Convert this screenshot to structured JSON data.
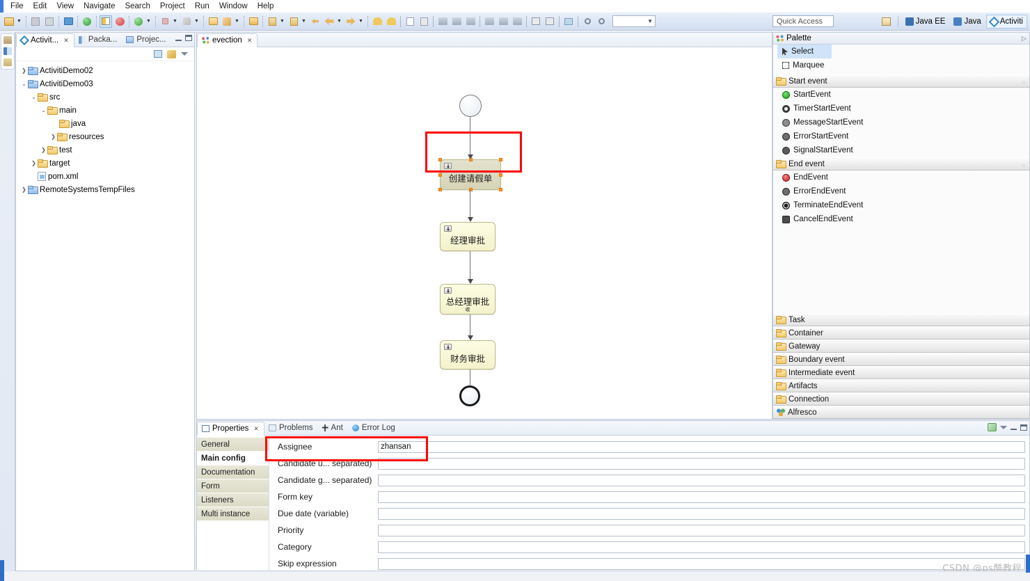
{
  "menubar": {
    "items": [
      "File",
      "Edit",
      "View",
      "Navigate",
      "Search",
      "Project",
      "Run",
      "Window",
      "Help"
    ]
  },
  "toolbar": {
    "quick_access_placeholder": "Quick Access",
    "zoom_combo_value": "",
    "perspectives": [
      {
        "label": "Java EE",
        "icon": "javaee-perspective-icon",
        "active": false
      },
      {
        "label": "Java",
        "icon": "java-perspective-icon",
        "active": false
      },
      {
        "label": "Activiti",
        "icon": "activiti-perspective-icon",
        "active": true
      }
    ],
    "open_perspective_icon": "open-perspective-icon"
  },
  "explorer": {
    "tabs": [
      {
        "label": "Activit...",
        "icon": "activiti-icon",
        "active": true,
        "closable": true
      },
      {
        "label": "Packa...",
        "icon": "package-explorer-icon",
        "active": false,
        "closable": false
      },
      {
        "label": "Projec...",
        "icon": "project-explorer-icon",
        "active": false,
        "closable": false
      }
    ],
    "view_actions": [
      "collapse-all-icon",
      "link-editor-icon",
      "view-menu-icon"
    ],
    "tree": [
      {
        "label": "ActivitiDemo02",
        "depth": 0,
        "twist": "collapsed",
        "icon": "project-folder"
      },
      {
        "label": "ActivitiDemo03",
        "depth": 0,
        "twist": "expanded",
        "icon": "project-folder"
      },
      {
        "label": "src",
        "depth": 1,
        "twist": "expanded",
        "icon": "folder"
      },
      {
        "label": "main",
        "depth": 2,
        "twist": "expanded",
        "icon": "folder"
      },
      {
        "label": "java",
        "depth": 3,
        "twist": "none",
        "icon": "folder"
      },
      {
        "label": "resources",
        "depth": 3,
        "twist": "collapsed",
        "icon": "folder"
      },
      {
        "label": "test",
        "depth": 2,
        "twist": "collapsed",
        "icon": "folder"
      },
      {
        "label": "target",
        "depth": 1,
        "twist": "collapsed",
        "icon": "folder"
      },
      {
        "label": "pom.xml",
        "depth": 1,
        "twist": "none",
        "icon": "file"
      },
      {
        "label": "RemoteSystemsTempFiles",
        "depth": 0,
        "twist": "collapsed",
        "icon": "project-folder"
      }
    ]
  },
  "editor": {
    "tab": {
      "label": "evection",
      "icon": "bpmn-diagram-icon",
      "closable": true
    },
    "diagram": {
      "start_event": {
        "name": "start-event"
      },
      "end_event": {
        "name": "end-event"
      },
      "tasks": [
        {
          "label": "创建请假单",
          "selected": true,
          "highlighted": true
        },
        {
          "label": "经理审批",
          "selected": false,
          "highlighted": false
        },
        {
          "label": "总经理审批",
          "sub_label": "收",
          "selected": false,
          "highlighted": false
        },
        {
          "label": "财务审批",
          "selected": false,
          "highlighted": false
        }
      ]
    }
  },
  "palette": {
    "title": "Palette",
    "tools": [
      {
        "label": "Select",
        "icon": "cursor-icon",
        "selected": true
      },
      {
        "label": "Marquee",
        "icon": "marquee-icon",
        "selected": false
      }
    ],
    "drawers": [
      {
        "label": "Start event",
        "expanded": true,
        "items": [
          {
            "label": "StartEvent",
            "icon": "start-event-icon",
            "color": "#27ae27"
          },
          {
            "label": "TimerStartEvent",
            "icon": "timer-start-event-icon",
            "color": "#3a3a3a"
          },
          {
            "label": "MessageStartEvent",
            "icon": "message-start-event-icon",
            "color": "#3a3a3a"
          },
          {
            "label": "ErrorStartEvent",
            "icon": "error-start-event-icon",
            "color": "#3a3a3a"
          },
          {
            "label": "SignalStartEvent",
            "icon": "signal-start-event-icon",
            "color": "#3a3a3a"
          }
        ]
      },
      {
        "label": "End event",
        "expanded": true,
        "items": [
          {
            "label": "EndEvent",
            "icon": "end-event-icon",
            "color": "#d23030"
          },
          {
            "label": "ErrorEndEvent",
            "icon": "error-end-event-icon",
            "color": "#3a3a3a"
          },
          {
            "label": "TerminateEndEvent",
            "icon": "terminate-end-event-icon",
            "color": "#3a3a3a"
          },
          {
            "label": "CancelEndEvent",
            "icon": "cancel-end-event-icon",
            "color": "#3a3a3a"
          }
        ]
      }
    ],
    "collapsed_drawers": [
      {
        "label": "Task",
        "icon": "folder-icon"
      },
      {
        "label": "Container",
        "icon": "folder-icon"
      },
      {
        "label": "Gateway",
        "icon": "folder-icon"
      },
      {
        "label": "Boundary event",
        "icon": "folder-icon"
      },
      {
        "label": "Intermediate event",
        "icon": "folder-icon"
      },
      {
        "label": "Artifacts",
        "icon": "folder-icon"
      },
      {
        "label": "Connection",
        "icon": "folder-icon"
      },
      {
        "label": "Alfresco",
        "icon": "alfresco-icon"
      }
    ]
  },
  "properties": {
    "tabs": [
      {
        "label": "Properties",
        "icon": "properties-icon",
        "active": true,
        "closable": true
      },
      {
        "label": "Problems",
        "icon": "problems-icon",
        "active": false,
        "closable": false
      },
      {
        "label": "Ant",
        "icon": "ant-icon",
        "active": false,
        "closable": false
      },
      {
        "label": "Error Log",
        "icon": "error-log-icon",
        "active": false,
        "closable": false
      }
    ],
    "side_tabs": [
      {
        "label": "General",
        "active": false
      },
      {
        "label": "Main config",
        "active": true
      },
      {
        "label": "Documentation",
        "active": false
      },
      {
        "label": "Form",
        "active": false
      },
      {
        "label": "Listeners",
        "active": false
      },
      {
        "label": "Multi instance",
        "active": false
      }
    ],
    "fields": [
      {
        "label": "Assignee",
        "value": "zhansan",
        "highlighted": true
      },
      {
        "label": "Candidate u... separated)",
        "value": "",
        "highlighted": false
      },
      {
        "label": "Candidate g... separated)",
        "value": "",
        "highlighted": false
      },
      {
        "label": "Form key",
        "value": "",
        "highlighted": false
      },
      {
        "label": "Due date (variable)",
        "value": "",
        "highlighted": false
      },
      {
        "label": "Priority",
        "value": "",
        "highlighted": false
      },
      {
        "label": "Category",
        "value": "",
        "highlighted": false
      },
      {
        "label": "Skip expression",
        "value": "",
        "highlighted": false
      }
    ],
    "view_actions": [
      "restore-icon",
      "view-menu-icon",
      "minimize-icon",
      "maximize-icon"
    ]
  },
  "watermark": "CSDN @ps酷教程",
  "colors": {
    "accent": "#fb0606",
    "selection": "#cfe3f9",
    "task_fill": "#f6f5d4",
    "handle": "#ff9326"
  }
}
